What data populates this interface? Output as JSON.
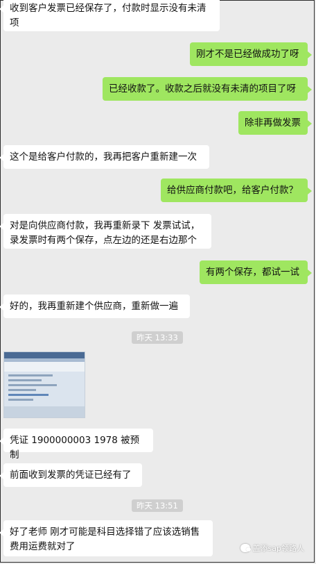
{
  "messages": [
    {
      "side": "left",
      "text": "收到客户发票已经保存了，付款时显示没有未清项"
    },
    {
      "side": "right",
      "text": "刚才不是已经做成功了呀"
    },
    {
      "side": "right",
      "text": "已经收款了。收款之后就没有未清的项目了呀"
    },
    {
      "side": "right",
      "text": "除非再做发票"
    },
    {
      "side": "left",
      "text": "这个是给客户付款的，我再把客户重新建一次"
    },
    {
      "side": "right",
      "text": "给供应商付款吧，给客户付款？"
    },
    {
      "side": "left",
      "text": "对是向供应商付款，我再重新录下 发票试试，录发票时有两个保存，点左边的还是右边那个"
    },
    {
      "side": "right",
      "text": "有两个保存，都试一试"
    },
    {
      "side": "left",
      "text": "好的，我再重新建个供应商，重新做一遍"
    },
    {
      "side": "left",
      "text": "凭证 1900000003 1978 被预制"
    },
    {
      "side": "left",
      "text": "前面收到发票的凭证已经有了"
    },
    {
      "side": "left",
      "text": "好了老师 刚才可能是科目选择错了应该选销售费用运费就对了"
    }
  ],
  "timestamps": [
    "昨天 13:33",
    "昨天 13:51"
  ],
  "watermark": "盖添sap领路人"
}
